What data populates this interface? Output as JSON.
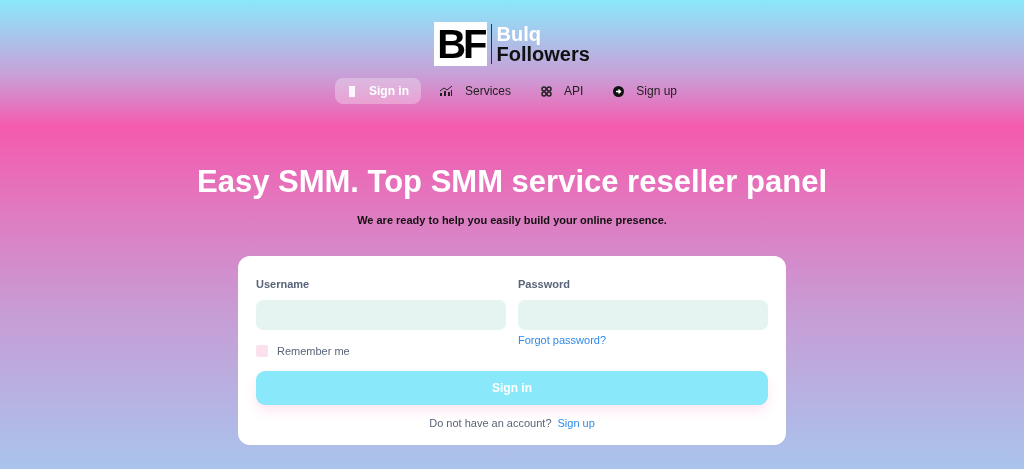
{
  "logo": {
    "mark": "BF",
    "line_1": "Bulq",
    "line_2": "Followers"
  },
  "nav": [
    {
      "label": "Sign in",
      "kind": "signin",
      "selected": true
    },
    {
      "label": "Services",
      "kind": "services",
      "selected": false
    },
    {
      "label": "API",
      "kind": "api",
      "selected": false
    },
    {
      "label": "Sign up",
      "kind": "signup",
      "selected": false
    }
  ],
  "headline": "Easy SMM. Top SMM service reseller panel",
  "subtitle": "We are ready to help you easily build your online presence.",
  "form": {
    "username_label": "Username",
    "password_label": "Password",
    "remember": {
      "label": "Remember me",
      "checked": false
    },
    "forgot": "Forgot password?",
    "submit": "Sign in",
    "footer_text": "Do not have an account?",
    "footer_link": "Sign up"
  }
}
